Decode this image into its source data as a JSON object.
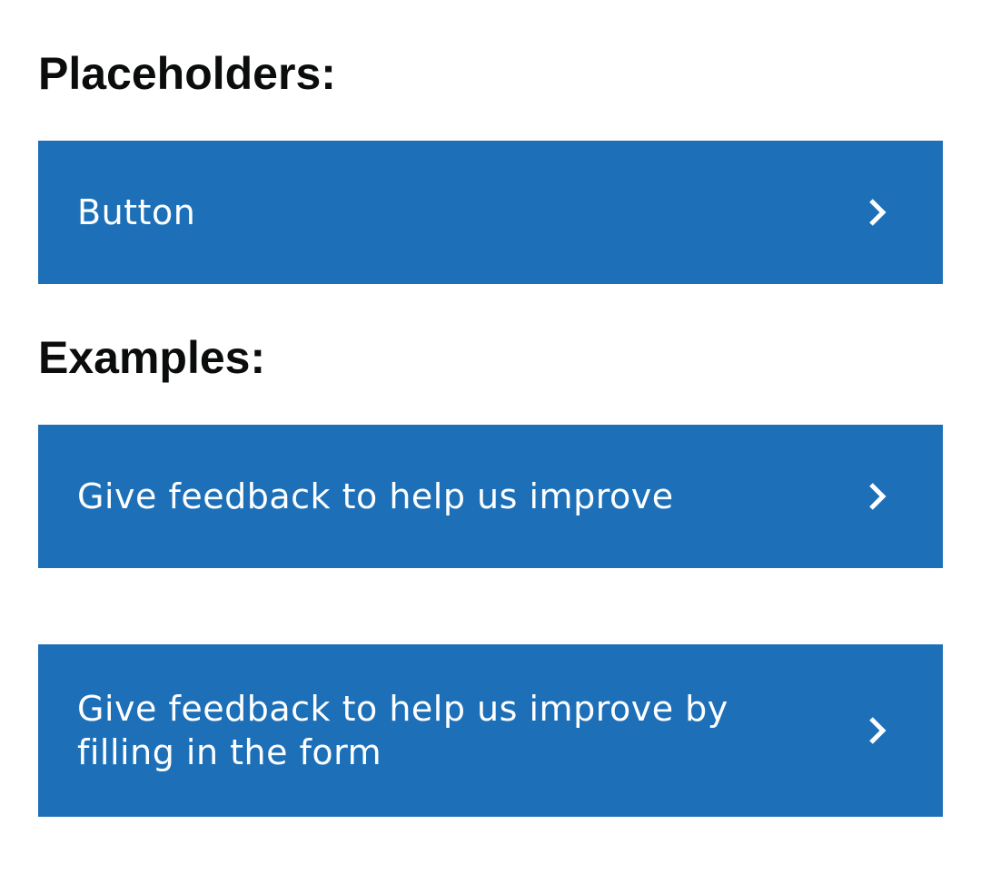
{
  "sections": {
    "placeholders": {
      "heading": "Placeholders:",
      "button_label": "Button"
    },
    "examples": {
      "heading": "Examples:",
      "buttons": [
        {
          "label": "Give feedback to help us improve"
        },
        {
          "label": "Give feedback to help us improve by filling in the form"
        }
      ]
    }
  },
  "icons": {
    "chevron": "chevron-right-icon"
  },
  "colors": {
    "button_background": "#1d70b8",
    "button_text": "#ffffff",
    "heading_text": "#0b0c0c",
    "page_background": "#ffffff"
  }
}
